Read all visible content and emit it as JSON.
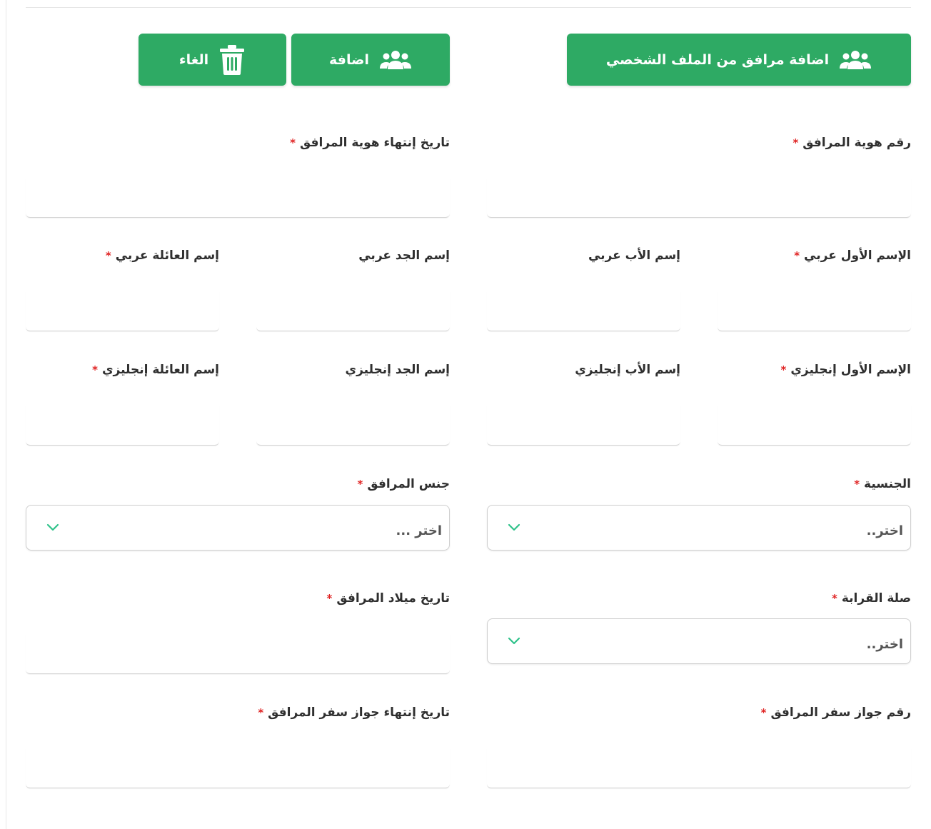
{
  "buttons": {
    "add_from_profile": "اضافة مرافق من الملف الشخصي",
    "add": "اضافة",
    "cancel": "الغاء"
  },
  "fields": {
    "id_number": "رقم هوية المرافق",
    "id_expiry": "تاريخ إنتهاء هوية المرافق",
    "first_name_ar": "الإسم الأول عربي",
    "father_name_ar": "إسم الأب عربي",
    "grandfather_name_ar": "إسم الجد عربي",
    "family_name_ar": "إسم العائلة عربي",
    "first_name_en": "الإسم الأول إنجليزي",
    "father_name_en": "إسم الأب إنجليزي",
    "grandfather_name_en": "إسم الجد إنجليزي",
    "family_name_en": "إسم العائلة إنجليزي",
    "nationality": "الجنسية",
    "gender": "جنس المرافق",
    "relation": "صلة القرابة",
    "birth_date": "تاريخ ميلاد المرافق",
    "passport_number": "رقم جواز سفر المرافق",
    "passport_expiry": "تاريخ إنتهاء جواز سفر المرافق"
  },
  "selects": {
    "nationality_value": "اختر..",
    "gender_value": "اختر ...",
    "relation_value": "اختر.."
  },
  "required_mark": "*",
  "colors": {
    "primary": "#2eaa64",
    "required": "#e02424",
    "chevron": "#2fc28a"
  }
}
